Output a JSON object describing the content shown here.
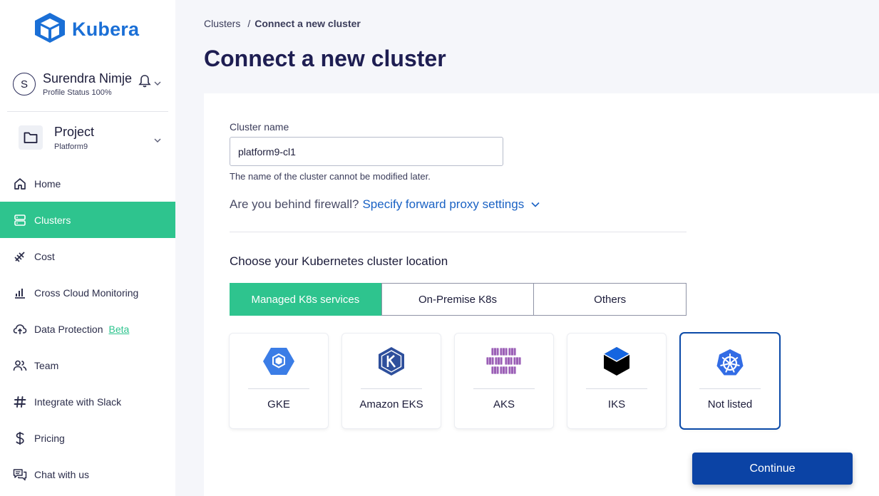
{
  "app": {
    "name": "Kubera"
  },
  "user": {
    "initial": "S",
    "name": "Surendra Nimje",
    "status": "Profile Status 100%"
  },
  "project": {
    "title": "Project",
    "name": "Platform9"
  },
  "nav": [
    {
      "label": "Home",
      "icon": "home-icon"
    },
    {
      "label": "Clusters",
      "icon": "clusters-icon",
      "active": true
    },
    {
      "label": "Cost",
      "icon": "cost-icon"
    },
    {
      "label": "Cross Cloud Monitoring",
      "icon": "monitoring-icon"
    },
    {
      "label": "Data Protection",
      "icon": "cloud-upload-icon",
      "badge": "Beta"
    },
    {
      "label": "Team",
      "icon": "team-icon"
    },
    {
      "label": "Integrate with Slack",
      "icon": "slack-icon"
    },
    {
      "label": "Pricing",
      "icon": "dollar-icon"
    },
    {
      "label": "Chat with us",
      "icon": "chat-icon"
    }
  ],
  "breadcrumb": {
    "root": "Clusters",
    "separator": "/",
    "current": "Connect a new cluster"
  },
  "page": {
    "title": "Connect a new cluster"
  },
  "form": {
    "cluster_name_label": "Cluster name",
    "cluster_name_value": "platform9-cl1",
    "cluster_name_hint": "The name of the cluster cannot be modified later.",
    "firewall_question": "Are you behind firewall?",
    "firewall_link": "Specify forward proxy settings"
  },
  "location": {
    "title": "Choose your Kubernetes cluster location",
    "tabs": [
      "Managed K8s services",
      "On-Premise K8s",
      "Others"
    ],
    "active_tab": 0
  },
  "providers": [
    {
      "name": "GKE",
      "icon": "gke-icon"
    },
    {
      "name": "Amazon EKS",
      "icon": "eks-icon"
    },
    {
      "name": "AKS",
      "icon": "aks-icon"
    },
    {
      "name": "IKS",
      "icon": "iks-icon"
    },
    {
      "name": "Not listed",
      "icon": "kubernetes-icon",
      "selected": true
    }
  ],
  "actions": {
    "continue": "Continue"
  },
  "colors": {
    "accent": "#2ec48e",
    "primary": "#0b43a5",
    "link": "#1a62c4",
    "title": "#1e1e52"
  }
}
